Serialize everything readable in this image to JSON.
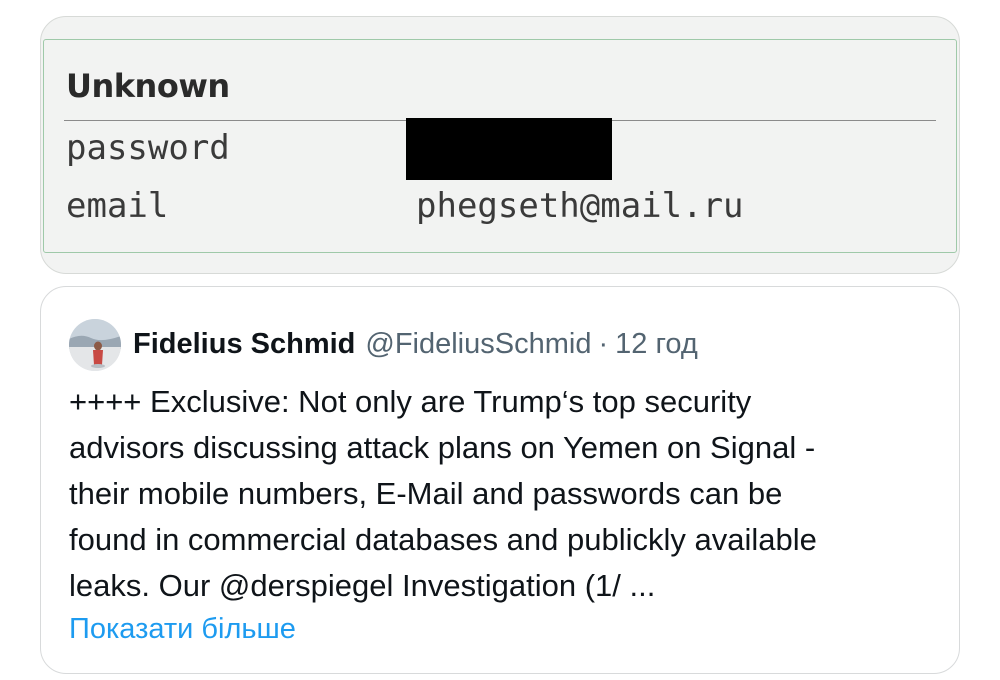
{
  "leak_record": {
    "title": "Unknown",
    "rows": [
      {
        "label": "password",
        "value": "",
        "redacted": true
      },
      {
        "label": "email",
        "value": "phegseth@mail.ru",
        "redacted": false
      }
    ]
  },
  "tweet": {
    "author_name": "Fidelius Schmid",
    "author_handle": "@FideliusSchmid",
    "separator": "·",
    "time": "12 год",
    "body_lines": [
      "++++ Exclusive: Not only are Trump‘s top security",
      "advisors discussing attack plans on Yemen on Signal -",
      "their mobile numbers, E-Mail and passwords can be",
      "found in commercial databases and publickly available"
    ],
    "last_line_prefix": "leaks. Our ",
    "mention": "@derspiegel",
    "last_line_suffix": " Investigation (1/ ...",
    "show_more_label": "Показати більше"
  },
  "colors": {
    "link": "#1d9bf0",
    "secondary_text": "#536471",
    "quoted_card_bg": "#f2f3f2",
    "panel_border": "#9fc9a9",
    "redaction": "#000000"
  },
  "icons": {
    "avatar": "profile-photo-avatar"
  }
}
